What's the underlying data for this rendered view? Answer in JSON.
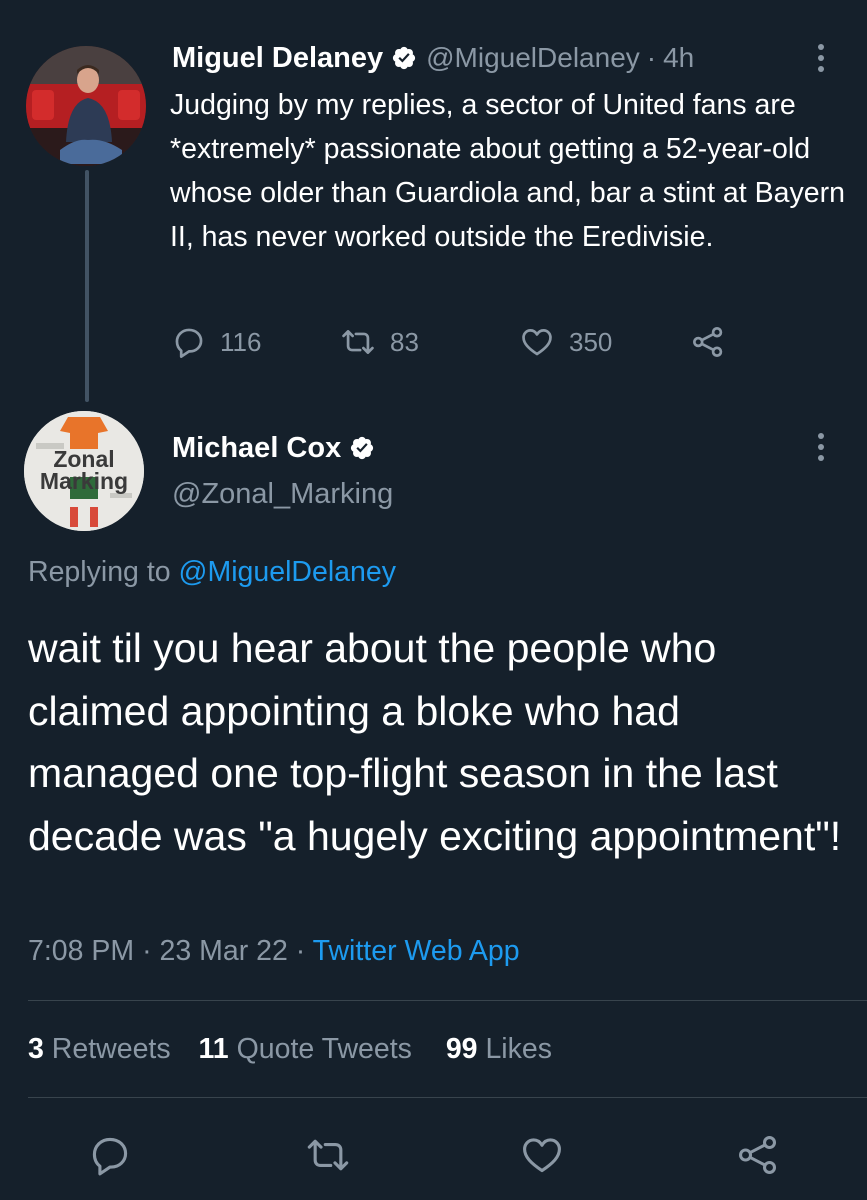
{
  "original_tweet": {
    "author_name": "Miguel Delaney",
    "handle": "@MiguelDelaney",
    "separator": "·",
    "time": "4h",
    "text": "Judging by my replies, a sector of United fans are *extremely* passionate about getting a 52-year-old whose older than Guardiola and, bar a stint at Bayern II, has never worked outside the Eredivisie.",
    "reply_count": "116",
    "retweet_count": "83",
    "like_count": "350"
  },
  "reply_tweet": {
    "author_name": "Michael Cox",
    "handle": "@Zonal_Marking",
    "avatar_text_line1": "Zonal",
    "avatar_text_line2": "Marking",
    "replying_to_label": "Replying to",
    "replying_to_handle": "@MiguelDelaney",
    "text": "wait til you hear about the people who claimed appointing a bloke who had managed one top-flight season in the last decade was \"a hugely exciting appointment\"!",
    "time": "7:08 PM",
    "date": "23 Mar 22",
    "separator": "·",
    "source": "Twitter Web App",
    "retweets_count": "3",
    "retweets_label": "Retweets",
    "quote_tweets_count": "11",
    "quote_tweets_label": "Quote Tweets",
    "likes_count": "99",
    "likes_label": "Likes"
  },
  "icons": {
    "verified": "verified-badge-icon",
    "reply": "reply-icon",
    "retweet": "retweet-icon",
    "like": "heart-icon",
    "share": "share-icon",
    "more": "more-options-icon"
  },
  "colors": {
    "background": "#15202b",
    "text": "#ffffff",
    "muted": "#8b98a5",
    "link": "#1d9bf0",
    "divider": "#38444d"
  }
}
